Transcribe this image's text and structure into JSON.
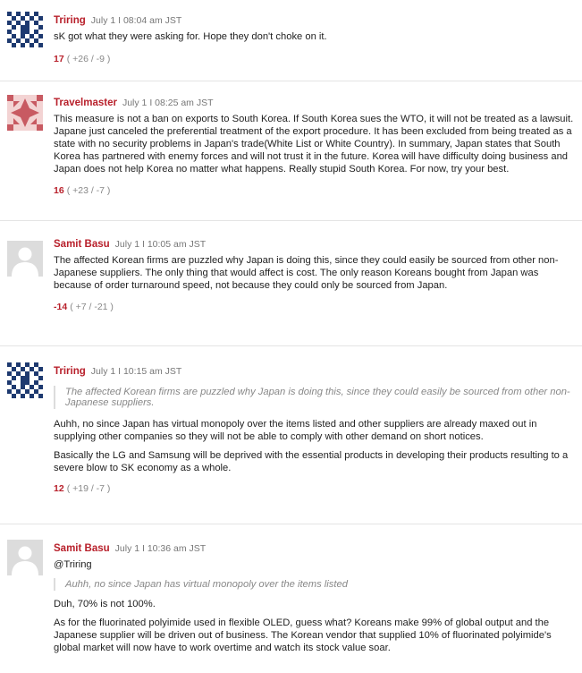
{
  "comments": [
    {
      "author": "Triring",
      "date": "July 1 I 08:04 am JST",
      "avatar": "blue-pattern-avatar",
      "quote": "",
      "paragraphs": [
        "sK got what they were asking for. Hope they don't choke on it."
      ],
      "score": "17",
      "vote_detail": "( +26 / -9 )"
    },
    {
      "author": "Travelmaster",
      "date": "July 1 I 08:25 am JST",
      "avatar": "pink-star-avatar",
      "quote": "",
      "paragraphs": [
        "This measure is not a ban on exports to South Korea. If South Korea sues the WTO, it will not be treated as a lawsuit. Japane just canceled the preferential treatment of the export procedure. It has been excluded from being treated as a state with no security problems in Japan's trade(White List or White Country). In summary, Japan states that South Korea has partnered with enemy forces and will not trust it in the future. Korea will have difficulty doing business and Japan does not help Korea no matter what happens. Really stupid South Korea. For now, try your best."
      ],
      "score": "16",
      "vote_detail": "( +23 / -7 )"
    },
    {
      "author": "Samit Basu",
      "date": "July 1 I 10:05 am JST",
      "avatar": "default-user-avatar",
      "quote": "",
      "paragraphs": [
        "The affected Korean firms are puzzled why Japan is doing this, since they could easily be sourced from other non-Japanese suppliers. The only thing that would affect is cost. The only reason Koreans bought from Japan was because of order turnaround speed, not because they could only be sourced from Japan."
      ],
      "score": "-14",
      "vote_detail": "( +7 / -21 )"
    },
    {
      "author": "Triring",
      "date": "July 1 I 10:15 am JST",
      "avatar": "blue-pattern-avatar",
      "quote": "The affected Korean firms are puzzled why Japan is doing this, since they could easily be sourced from other non-Japanese suppliers.",
      "paragraphs": [
        "Auhh, no since Japan has virtual monopoly over the items listed and other suppliers are already maxed out in supplying other companies so they will not be able to comply with other demand on short notices.",
        "Basically the LG and Samsung will be deprived with the essential products in developing their products resulting to a severe blow to SK economy as a whole."
      ],
      "score": "12",
      "vote_detail": "( +19 / -7 )"
    },
    {
      "author": "Samit Basu",
      "date": "July 1 I 10:36 am JST",
      "avatar": "default-user-avatar",
      "mention": "@Triring",
      "quote": "Auhh, no since Japan has virtual monopoly over the items listed",
      "paragraphs": [
        "Duh, 70% is not 100%.",
        "As for the fluorinated polyimide used in flexible OLED, guess what? Koreans make 99% of global output and the Japanese supplier will be driven out of business. The Korean vendor that supplied 10% of fluorinated polyimide's global market will now have to work overtime and watch its stock value soar."
      ],
      "score": "",
      "vote_detail": ""
    }
  ]
}
